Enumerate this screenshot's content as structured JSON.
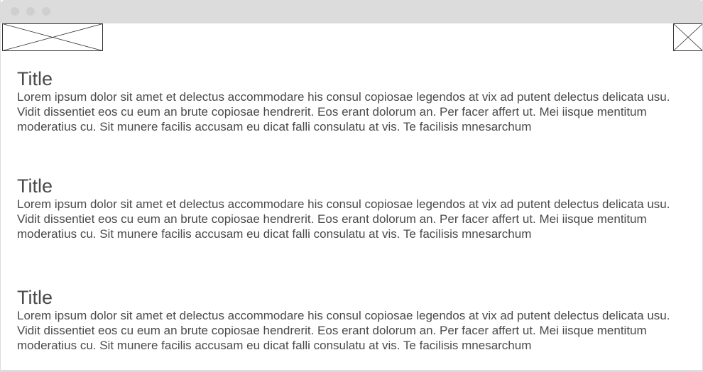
{
  "sections": [
    {
      "title": "Title",
      "body": "Lorem ipsum dolor sit amet et delectus accommodare his consul copiosae legendos at vix ad putent delectus delicata usu. Vidit dissentiet eos cu eum an brute copiosae hendrerit. Eos erant dolorum an. Per facer affert ut. Mei iisque mentitum moderatius cu. Sit munere facilis accusam eu dicat falli consulatu at vis. Te facilisis mnesarchum"
    },
    {
      "title": "Title",
      "body": "Lorem ipsum dolor sit amet et delectus accommodare his consul copiosae legendos at vix ad putent delectus delicata usu. Vidit dissentiet eos cu eum an brute copiosae hendrerit. Eos erant dolorum an. Per facer affert ut. Mei iisque mentitum moderatius cu. Sit munere facilis accusam eu dicat falli consulatu at vis. Te facilisis mnesarchum"
    },
    {
      "title": "Title",
      "body": "Lorem ipsum dolor sit amet et delectus accommodare his consul copiosae legendos at vix ad putent delectus delicata usu. Vidit dissentiet eos cu eum an brute copiosae hendrerit. Eos erant dolorum an. Per facer affert ut. Mei iisque mentitum moderatius cu. Sit munere facilis accusam eu dicat falli consulatu at vis. Te facilisis mnesarchum"
    }
  ],
  "colors": {
    "text": "#4a4a4a",
    "titlebar": "#dcdcdc",
    "placeholder_stroke": "#333333"
  },
  "icons": {
    "window_controls": [
      "close-dot",
      "minimize-dot",
      "maximize-dot"
    ],
    "placeholders": [
      "image-placeholder-icon",
      "image-placeholder-icon"
    ]
  }
}
